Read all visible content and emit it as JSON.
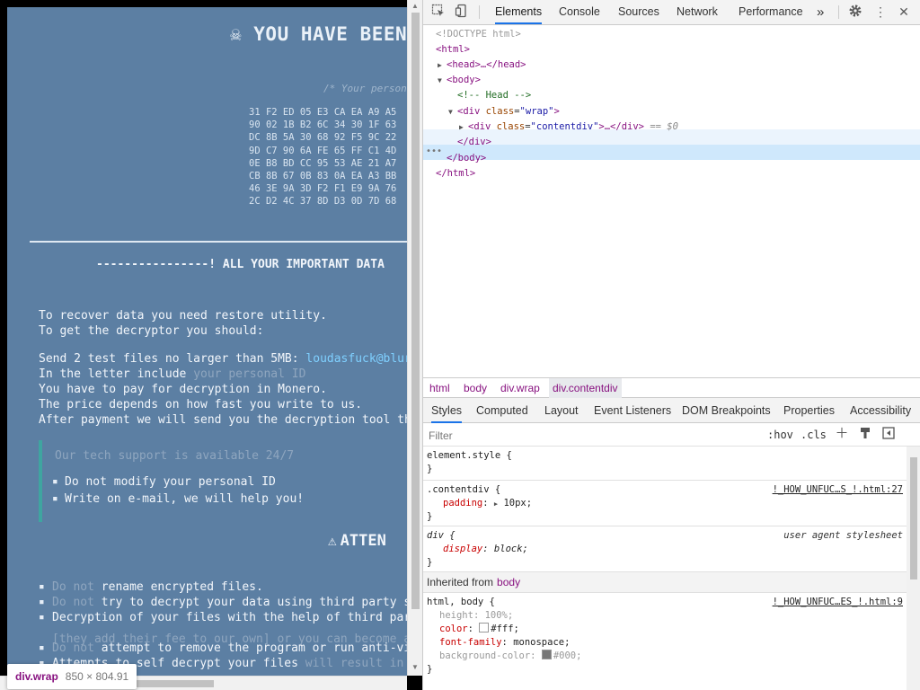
{
  "page": {
    "title": "☠ YOU HAVE BEEN",
    "id_comment": "/* Your personal ID */",
    "hex_lines": [
      "31 F2 ED 05 E3 CA EA A9 A5",
      "90 02 1B B2 6C 34 30 1F 63",
      "DC 8B 5A 30 68 92 F5 9C 22",
      "9D C7 90 6A FE 65 FF C1 4D",
      "0E B8 BD CC 95 53 AE 21 A7",
      "CB 8B 67 0B 83 0A EA A3 BB",
      "46 3E 9A 3D F2 F1 E9 9A 76",
      "2C D2 4C 37 8D D3 0D 7D 68"
    ],
    "important_header": "----------------! ALL YOUR IMPORTANT DATA",
    "p1": "To recover data you need restore utility.",
    "p2": "To get the decryptor you should:",
    "p3_text": "Send 2 test files no larger than 5MB: ",
    "p3_email": "loudasfuck@blur",
    "p4_text": "In the letter include ",
    "p4_dim": "your personal ID",
    "p5": "You have to pay for decryption in Monero.",
    "p6": "The price depends on how fast you write to us.",
    "p7": "After payment we will send you the decryption tool th",
    "support_title": "Our tech support is available 24/7",
    "support_items": [
      "Do not modify your personal ID",
      "Write on e-mail, we will help you!"
    ],
    "attention_icon": "⚠",
    "attention": "ATTEN",
    "warn_items": [
      {
        "dim": "Do not",
        "text": " rename encrypted files."
      },
      {
        "dim": "Do not",
        "text": " try to decrypt your data using third party s"
      },
      {
        "dim": "",
        "text": "Decryption of your files with the help of third par"
      },
      {
        "dim": "Do not",
        "text": " attempt to remove the program or run anti-vi"
      },
      {
        "dim": "",
        "text": "Attempts to self decrypt your files ",
        "tail": "will result in"
      }
    ],
    "sub_note": "[they add their fee to our own] or you can become a"
  },
  "tooltip": {
    "tag": "div.wrap",
    "dims": "850 × 804.91"
  },
  "devtools": {
    "tabs": [
      "Elements",
      "Console",
      "Sources",
      "Network",
      "Performance"
    ],
    "more": "»",
    "tree": {
      "doctype": "<!DOCTYPE html>",
      "html_open": "<html>",
      "head": "<head>…</head>",
      "body_open": "<body>",
      "comment": "<!-- Head -->",
      "wrap_tag": "<div ",
      "wrap_attr": "class",
      "wrap_val": "\"wrap\"",
      "content_tag": "<div ",
      "content_attr": "class",
      "content_val": "\"contentdiv\"",
      "content_close": ">…</div>",
      "dollar": "== $0",
      "div_close": "</div>",
      "body_close": "</body>",
      "html_close": "</html>"
    },
    "breadcrumbs": [
      "html",
      "body",
      "div.wrap",
      "div.contentdiv"
    ],
    "style_tabs": [
      "Styles",
      "Computed",
      "Layout",
      "Event Listeners",
      "DOM Breakpoints",
      "Properties",
      "Accessibility"
    ],
    "filter_placeholder": "Filter",
    "hov": ":hov",
    "cls": ".cls",
    "rules": {
      "element_style": "element.style {",
      "close": "}",
      "contentdiv_sel": ".contentdiv {",
      "contentdiv_src": "!_HOW_UNFUC…S_!.html:27",
      "padding_prop": "padding",
      "padding_val": "10px;",
      "div_sel": "div {",
      "div_src": "user agent stylesheet",
      "display_prop": "display",
      "display_val": "block;",
      "inherited_label": "Inherited from",
      "inherited_elem": "body",
      "htmlbody_sel": "html, body {",
      "htmlbody_src": "!_HOW_UNFUC…ES_!.html:9",
      "height_prop": "height",
      "height_val": "100%;",
      "color_prop": "color",
      "color_val": "#fff;",
      "font_prop": "font-family",
      "font_val": "monospace;",
      "bg_prop": "background-color",
      "bg_val": "#000;"
    }
  },
  "colors": {
    "page_overlay": "#5c7fa3",
    "accent": "#1a73e8",
    "email": "#7fd0ff"
  }
}
